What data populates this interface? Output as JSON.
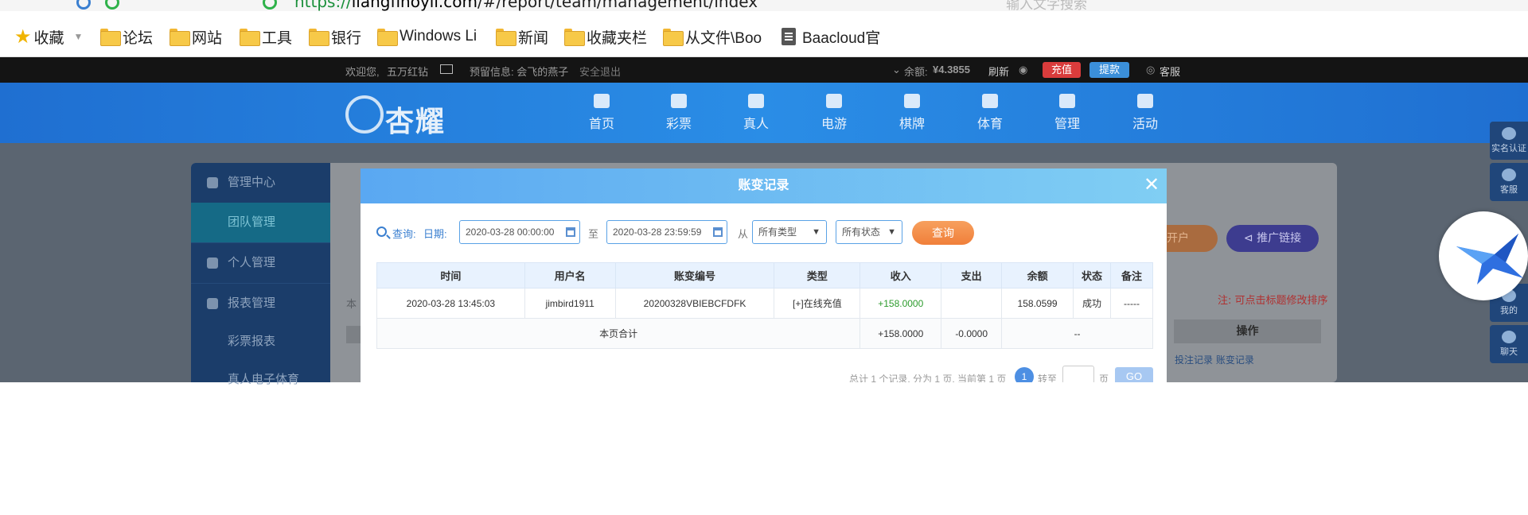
{
  "browser": {
    "url_scheme": "https://",
    "url_host": "ilangfinoyil.com",
    "url_path": "/#/report/team/management/index",
    "search_placeholder": "输入文字搜索",
    "bookmarks": [
      {
        "label": "收藏",
        "icon": "star-icon"
      },
      {
        "label": "论坛",
        "icon": "folder-icon"
      },
      {
        "label": "网站",
        "icon": "folder-icon"
      },
      {
        "label": "工具",
        "icon": "folder-icon"
      },
      {
        "label": "银行",
        "icon": "folder-icon"
      },
      {
        "label": "Windows Li",
        "icon": "folder-icon"
      },
      {
        "label": "新闻",
        "icon": "folder-icon"
      },
      {
        "label": "收藏夹栏",
        "icon": "folder-icon"
      },
      {
        "label": "从文件\\Boo",
        "icon": "folder-icon"
      },
      {
        "label": "Baacloud官",
        "icon": "document-icon"
      }
    ]
  },
  "topbar": {
    "welcome": "欢迎您,",
    "username": "五万红钻",
    "reserved_label": "预留信息: 会飞的燕子",
    "logout": "安全退出",
    "balance_label": "余额:",
    "balance_value": "¥4.3855",
    "refresh": "刷新",
    "recharge": "充值",
    "withdraw": "提款",
    "service": "客服"
  },
  "site": {
    "logo_text": "杏耀",
    "nav": [
      "首页",
      "彩票",
      "真人",
      "电游",
      "棋牌",
      "体育",
      "管理",
      "活动"
    ]
  },
  "sidebar": {
    "items": [
      {
        "label": "管理中心",
        "type": "header"
      },
      {
        "label": "团队管理",
        "type": "active"
      },
      {
        "label": "个人管理",
        "type": "header"
      },
      {
        "label": "报表管理",
        "type": "header"
      },
      {
        "label": "彩票报表",
        "type": "sub"
      },
      {
        "label": "真人电子体育",
        "type": "sub"
      }
    ]
  },
  "background_page": {
    "open_account": "开户",
    "share_link": "推广链接",
    "sort_note": "注: 可点击标题修改排序",
    "op_header": "操作",
    "op_links": "投注记录 账变记录",
    "partial_left_label": "本"
  },
  "rightbar": {
    "items": [
      "实名认证",
      "客服",
      "我的",
      "聊天"
    ]
  },
  "modal": {
    "title": "账变记录",
    "query_label": "查询:",
    "date_label": "日期:",
    "date_from": "2020-03-28 00:00:00",
    "to_label": "至",
    "date_to": "2020-03-28 23:59:59",
    "from_label": "从",
    "type_select": "所有类型",
    "status_select": "所有状态",
    "query_button": "查询",
    "columns": [
      "时间",
      "用户名",
      "账变编号",
      "类型",
      "收入",
      "支出",
      "余额",
      "状态",
      "备注"
    ],
    "rows": [
      {
        "time": "2020-03-28 13:45:03",
        "user": "jimbird1911",
        "id": "20200328VBIEBCFDFK",
        "type": "[+]在线充值",
        "income": "+158.0000",
        "expense": "",
        "balance": "158.0599",
        "status": "成功",
        "remark": "-----"
      }
    ],
    "summary": {
      "label": "本页合计",
      "income": "+158.0000",
      "expense": "-0.0000",
      "rest": "--"
    },
    "pager": {
      "info": "总计 1 个记录, 分为 1 页, 当前第 1 页",
      "current": "1",
      "jump_label": "转至",
      "page_label": "页",
      "go": "GO"
    }
  }
}
